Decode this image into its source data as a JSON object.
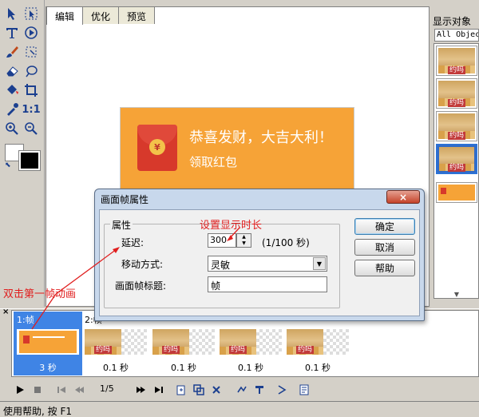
{
  "toolbox": {
    "tools": [
      "select-arrow-icon",
      "frame-select-icon",
      "text-icon",
      "play-circle-icon",
      "brush-icon",
      "lasso-icon",
      "eraser-icon",
      "magic-wand-icon",
      "fill-bucket-icon",
      "crop-icon",
      "eyedropper-icon",
      "zoom-actual",
      "zoom-in-icon",
      "zoom-out-icon"
    ],
    "actual_size_label": "1:1",
    "foreground_color": "#ffffff",
    "background_color": "#000000"
  },
  "editor": {
    "tabs": [
      {
        "label": "编辑",
        "active": true
      },
      {
        "label": "优化",
        "active": false
      },
      {
        "label": "预览",
        "active": false
      }
    ]
  },
  "preview": {
    "line1": "恭喜发财，大吉大利！",
    "line2": "领取红包",
    "coin_symbol": "¥",
    "bg_color": "#f6a337",
    "envelope_color": "#d7392b"
  },
  "objects_panel": {
    "title": "显示对象",
    "filter_value": "All Objec",
    "thumb_label": "约吗"
  },
  "dialog": {
    "title": "画面帧属性",
    "close_symbol": "×",
    "group_label": "属性",
    "delay_label": "延迟:",
    "delay_value": "300",
    "delay_unit": "(1/100 秒)",
    "motion_label": "移动方式:",
    "motion_value": "灵敏",
    "frame_title_label": "画面帧标题:",
    "frame_title_value": "帧",
    "ok_label": "确定",
    "cancel_label": "取消",
    "help_label": "帮助"
  },
  "frames": {
    "close_symbol": "×",
    "items": [
      {
        "title": "1:帧",
        "time": "3 秒",
        "selected": true
      },
      {
        "title": "2:帧",
        "time": "0.1 秒",
        "selected": false
      },
      {
        "title": "",
        "time": "0.1 秒",
        "selected": false
      },
      {
        "title": "",
        "time": "0.1 秒",
        "selected": false
      },
      {
        "title": "",
        "time": "0.1 秒",
        "selected": false
      }
    ],
    "thumb_label": "约吗"
  },
  "frame_toolbar": {
    "counter": "1/5"
  },
  "statusbar": {
    "text": "使用帮助, 按 F1"
  },
  "annotations": {
    "set_duration": "设置显示时长",
    "double_click": "双击第一帧动画",
    "color": "#e01f1f"
  }
}
